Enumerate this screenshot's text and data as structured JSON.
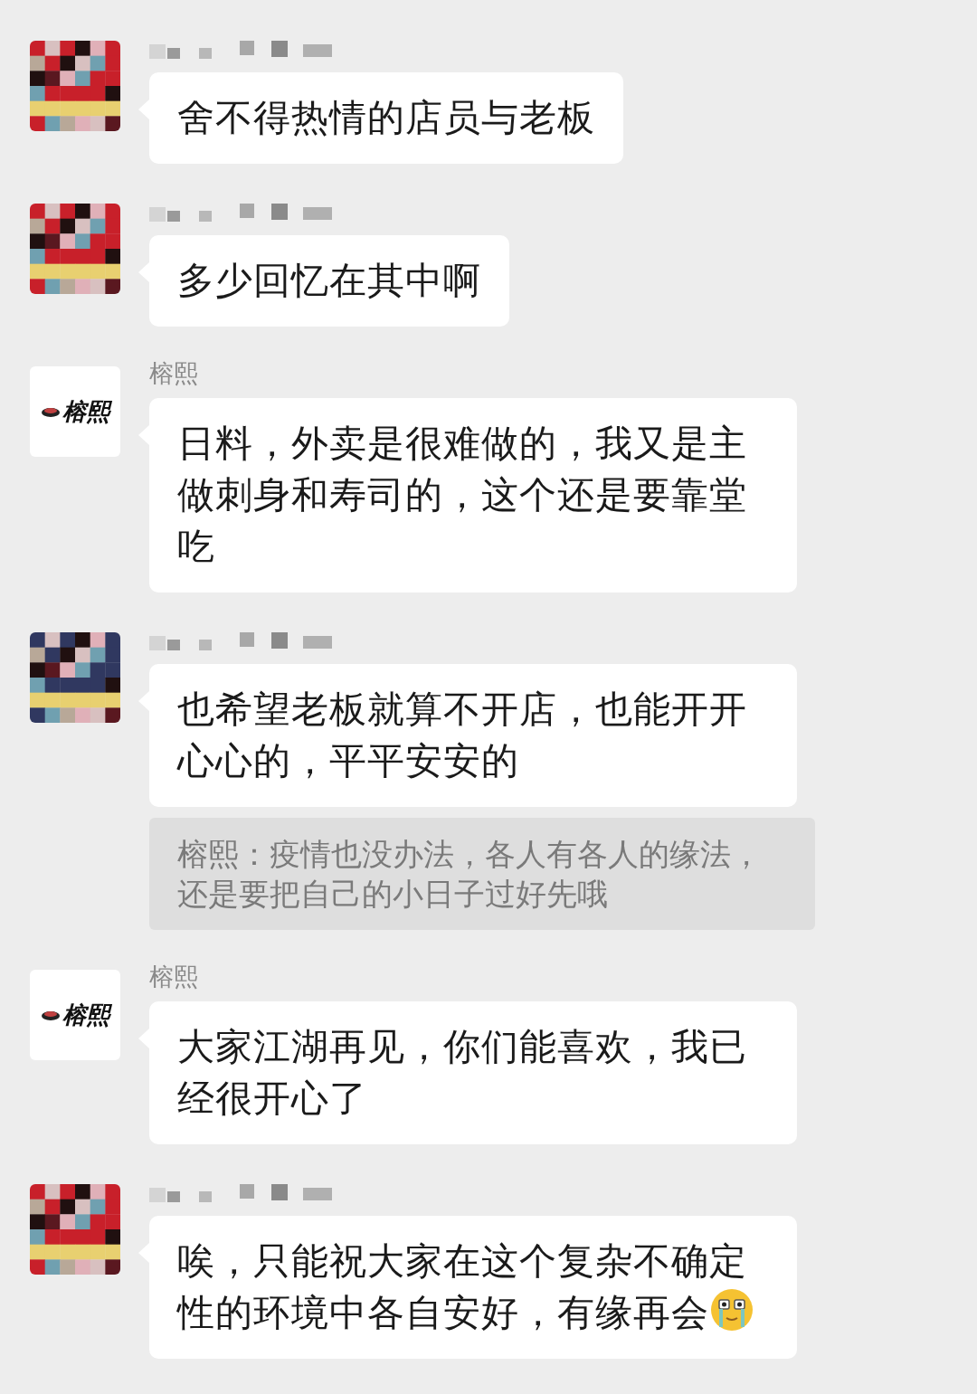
{
  "messages": [
    {
      "avatar": {
        "kind": "mosaic",
        "color": "#c8202a"
      },
      "sender": {
        "kind": "hidden"
      },
      "text": "舍不得热情的店员与老板"
    },
    {
      "avatar": {
        "kind": "mosaic",
        "color": "#c8202a"
      },
      "sender": {
        "kind": "hidden"
      },
      "text": "多少回忆在其中啊"
    },
    {
      "avatar": {
        "kind": "logo",
        "text": "榕熙"
      },
      "sender": {
        "kind": "name",
        "text": "榕熙"
      },
      "text": "日料，外卖是很难做的，我又是主做刺身和寿司的，这个还是要靠堂吃"
    },
    {
      "avatar": {
        "kind": "mosaic",
        "color": "#303860"
      },
      "sender": {
        "kind": "hidden"
      },
      "text": "也希望老板就算不开店，也能开开心心的，平平安安的",
      "quote": "榕熙：疫情也没办法，各人有各人的缘法，还是要把自己的小日子过好先哦"
    },
    {
      "avatar": {
        "kind": "logo",
        "text": "榕熙"
      },
      "sender": {
        "kind": "name",
        "text": "榕熙"
      },
      "text": "大家江湖再见，你们能喜欢，我已经很开心了"
    },
    {
      "avatar": {
        "kind": "mosaic",
        "color": "#c8202a"
      },
      "sender": {
        "kind": "hidden"
      },
      "text": "唉，只能祝大家在这个复杂不确定性的环境中各自安好，有缘再会",
      "emoji": true
    }
  ]
}
